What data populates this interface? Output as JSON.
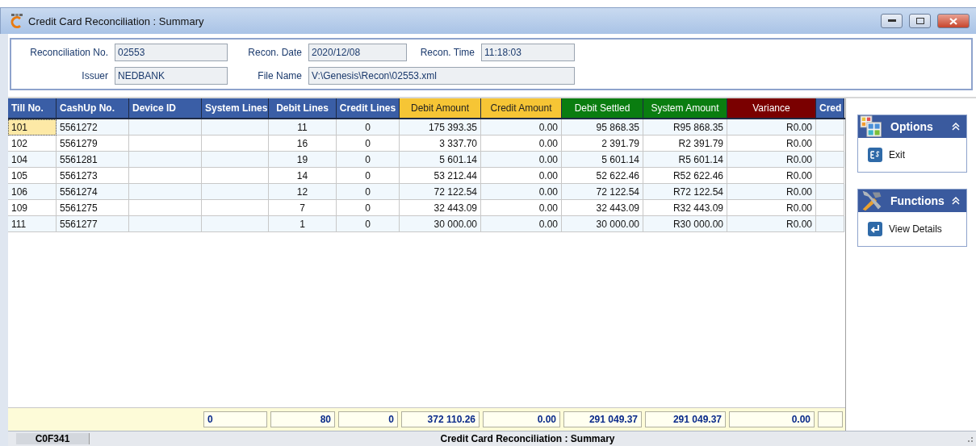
{
  "window": {
    "title": "Credit Card Reconciliation : Summary"
  },
  "header_fields": [
    {
      "label": "Reconciliation No.",
      "value": "02553"
    },
    {
      "label": "Recon. Date",
      "value": "2020/12/08"
    },
    {
      "label": "Recon. Time",
      "value": "11:18:03"
    },
    {
      "label": "Issuer",
      "value": "NEDBANK"
    },
    {
      "label": "File Name",
      "value": "V:\\Genesis\\Recon\\02553.xml"
    }
  ],
  "table": {
    "columns": [
      {
        "label": "Till No.",
        "kind": "plain"
      },
      {
        "label": "CashUp No.",
        "kind": "plain"
      },
      {
        "label": "Device ID",
        "kind": "plain"
      },
      {
        "label": "System Lines",
        "kind": "plain",
        "total": "0"
      },
      {
        "label": "Debit Lines",
        "kind": "count",
        "total": "80"
      },
      {
        "label": "Credit Lines",
        "kind": "count",
        "total": "0"
      },
      {
        "label": "Debit Amount",
        "kind": "amount",
        "total": "372 110.26"
      },
      {
        "label": "Credit Amount",
        "kind": "amount",
        "total": "0.00"
      },
      {
        "label": "Debit Settled",
        "kind": "settled",
        "total": "291 049.37"
      },
      {
        "label": "System Amount",
        "kind": "settled",
        "total": "291 049.37"
      },
      {
        "label": "Variance",
        "kind": "variance",
        "total": "0.00"
      },
      {
        "label": "Cred",
        "kind": "extra"
      }
    ],
    "rows": [
      {
        "selected": true,
        "till_no": "101",
        "cashup_no": "5561272",
        "debit_lines": "11",
        "credit_lines": "0",
        "debit_amount": "175 393.35",
        "credit_amount": "0.00",
        "debit_settled": "95 868.35",
        "system_amount": "R95 868.35",
        "variance": "R0.00"
      },
      {
        "selected": false,
        "till_no": "102",
        "cashup_no": "5561279",
        "debit_lines": "16",
        "credit_lines": "0",
        "debit_amount": "3 337.70",
        "credit_amount": "0.00",
        "debit_settled": "2 391.79",
        "system_amount": "R2 391.79",
        "variance": "R0.00"
      },
      {
        "selected": false,
        "till_no": "104",
        "cashup_no": "5561281",
        "debit_lines": "19",
        "credit_lines": "0",
        "debit_amount": "5 601.14",
        "credit_amount": "0.00",
        "debit_settled": "5 601.14",
        "system_amount": "R5 601.14",
        "variance": "R0.00"
      },
      {
        "selected": false,
        "till_no": "105",
        "cashup_no": "5561273",
        "debit_lines": "14",
        "credit_lines": "0",
        "debit_amount": "53 212.44",
        "credit_amount": "0.00",
        "debit_settled": "52 622.46",
        "system_amount": "R52 622.46",
        "variance": "R0.00"
      },
      {
        "selected": false,
        "till_no": "106",
        "cashup_no": "5561274",
        "debit_lines": "12",
        "credit_lines": "0",
        "debit_amount": "72 122.54",
        "credit_amount": "0.00",
        "debit_settled": "72 122.54",
        "system_amount": "R72 122.54",
        "variance": "R0.00"
      },
      {
        "selected": false,
        "till_no": "109",
        "cashup_no": "5561275",
        "debit_lines": "7",
        "credit_lines": "0",
        "debit_amount": "32 443.09",
        "credit_amount": "0.00",
        "debit_settled": "32 443.09",
        "system_amount": "R32 443.09",
        "variance": "R0.00"
      },
      {
        "selected": false,
        "till_no": "111",
        "cashup_no": "5561277",
        "debit_lines": "1",
        "credit_lines": "0",
        "debit_amount": "30 000.00",
        "credit_amount": "0.00",
        "debit_settled": "30 000.00",
        "system_amount": "R30 000.00",
        "variance": "R0.00"
      }
    ]
  },
  "side_panels": [
    {
      "title": "Options",
      "kind": "options",
      "expanded": true,
      "items": [
        {
          "label": "Exit",
          "kind": "esc"
        }
      ]
    },
    {
      "title": "Functions",
      "kind": "functions",
      "expanded": true,
      "items": [
        {
          "label": "View Details",
          "kind": "enter"
        }
      ]
    }
  ],
  "status_bar": {
    "code": "C0F341",
    "title": "Credit Card Reconciliation : Summary"
  }
}
